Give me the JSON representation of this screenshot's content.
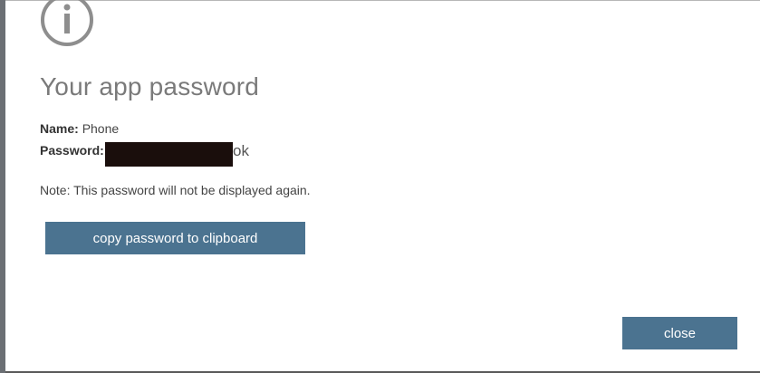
{
  "dialog": {
    "title": "Your app password",
    "name_label": "Name:",
    "name_value": "Phone",
    "password_label": "Password:",
    "password_visible_suffix": "ok",
    "note": "Note: This password will not be displayed again.",
    "copy_button_label": "copy password to clipboard",
    "close_button_label": "close",
    "icon": "info-icon"
  },
  "colors": {
    "button_bg": "#4b7390",
    "button_text": "#ffffff",
    "title_text": "#7a7a7a",
    "icon_stroke": "#8e8e8e",
    "redaction": "#1a0e0c"
  }
}
